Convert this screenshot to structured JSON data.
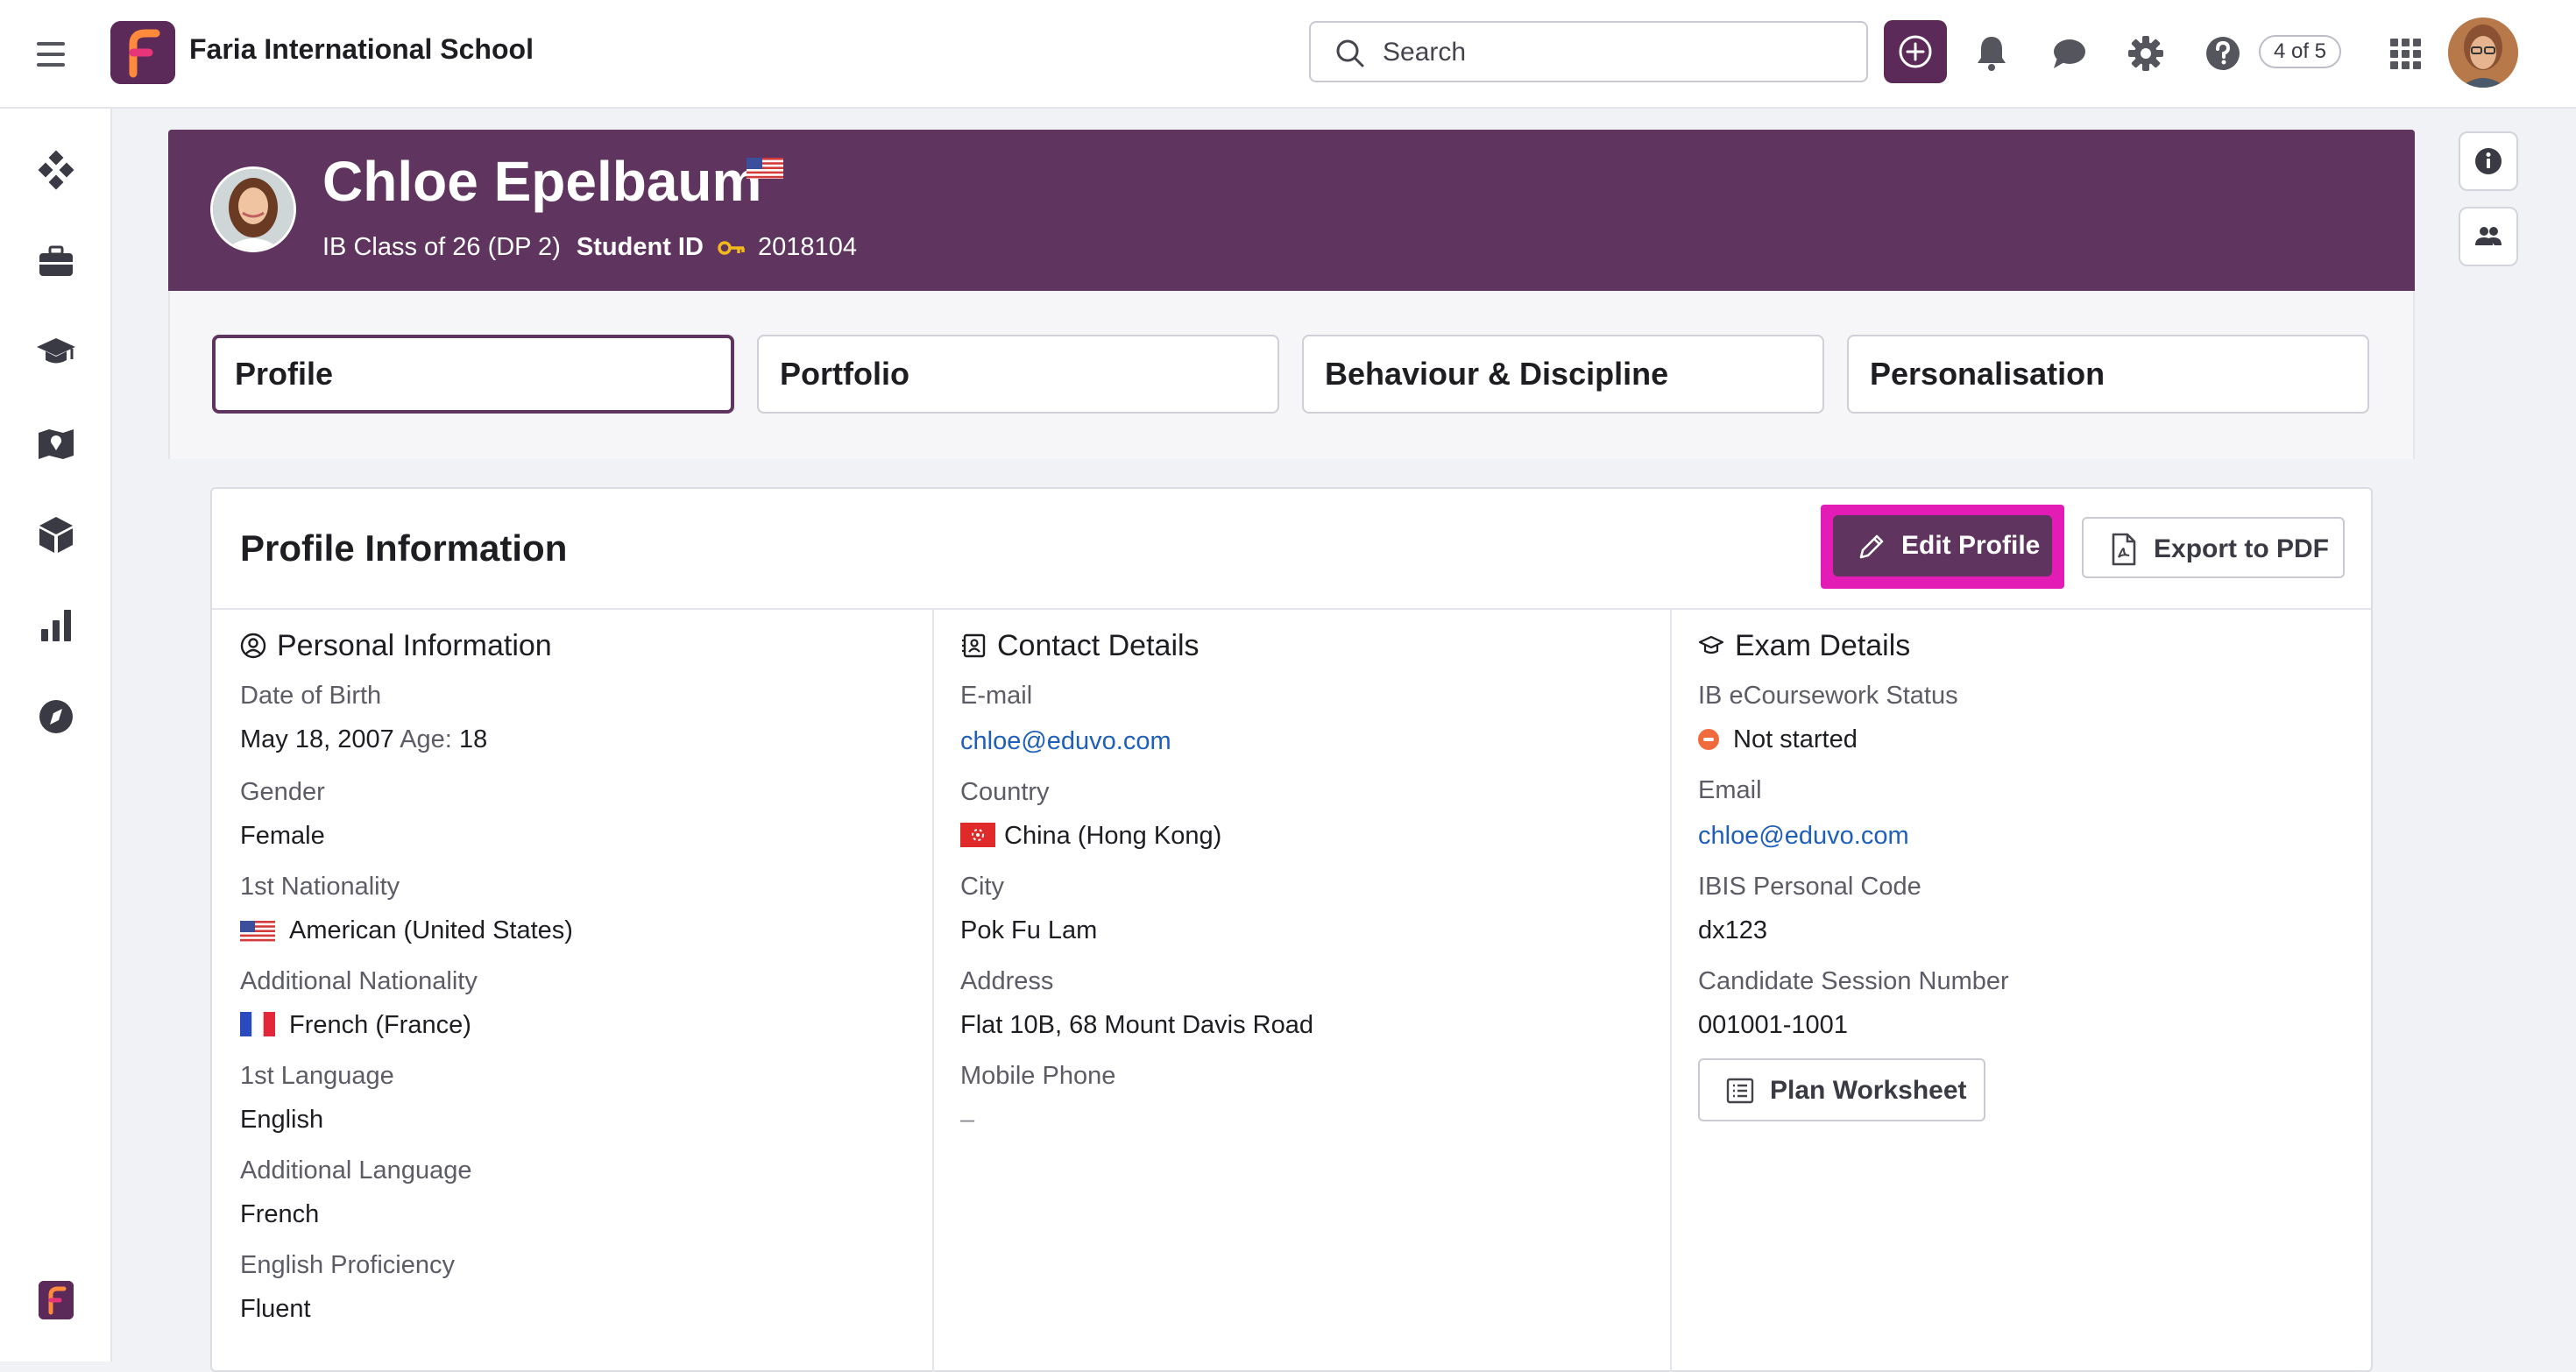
{
  "app": {
    "school_name": "Faria International School",
    "search_placeholder": "Search",
    "notification_count": "4 of 5",
    "brand_color": "#5f345f",
    "accent_highlight": "#e21cb4",
    "icons": [
      "menu-icon",
      "notifications-icon",
      "messages-icon",
      "settings-icon",
      "help-icon",
      "apps-grid-icon"
    ]
  },
  "sidebar": {
    "items": [
      {
        "icon": "dashboard-icon"
      },
      {
        "icon": "briefcase-icon"
      },
      {
        "icon": "graduation-cap-icon"
      },
      {
        "icon": "map-icon"
      },
      {
        "icon": "cube-icon"
      },
      {
        "icon": "bar-chart-icon"
      },
      {
        "icon": "compass-icon"
      }
    ]
  },
  "student": {
    "name": "Chloe Epelbaum",
    "class": "IB Class of 26 (DP 2)",
    "id_label": "Student ID",
    "id_value": "2018104",
    "flag": "us-flag"
  },
  "tabs": [
    "Profile",
    "Portfolio",
    "Behaviour & Discipline",
    "Personalisation"
  ],
  "active_tab": "Profile",
  "card": {
    "title": "Profile Information",
    "edit_label": "Edit Profile",
    "export_label": "Export to PDF"
  },
  "personal": {
    "heading": "Personal Information",
    "dob_label": "Date of Birth",
    "dob_value": "May 18, 2007",
    "age_label": "Age:",
    "age_value": "18",
    "gender_label": "Gender",
    "gender_value": "Female",
    "nationality_label": "1st Nationality",
    "nationality_value": "American (United States)",
    "add_nationality_label": "Additional Nationality",
    "add_nationality_value": "French (France)",
    "language_label": "1st Language",
    "language_value": "English",
    "add_language_label": "Additional Language",
    "add_language_value": "French",
    "proficiency_label": "English Proficiency",
    "proficiency_value": "Fluent"
  },
  "contact": {
    "heading": "Contact Details",
    "email_label": "E-mail",
    "email_value": "chloe@eduvo.com",
    "country_label": "Country",
    "country_value": "China (Hong Kong)",
    "city_label": "City",
    "city_value": "Pok Fu Lam",
    "address_label": "Address",
    "address_value": "Flat 10B, 68 Mount Davis Road",
    "phone_label": "Mobile Phone",
    "phone_value": "–"
  },
  "exam": {
    "heading": "Exam Details",
    "ecoursework_label": "IB eCoursework Status",
    "ecoursework_value": "Not started",
    "email_label": "Email",
    "email_value": "chloe@eduvo.com",
    "ibis_label": "IBIS Personal Code",
    "ibis_value": "dx123",
    "session_label": "Candidate Session Number",
    "session_value": "001001-1001",
    "plan_label": "Plan Worksheet"
  }
}
